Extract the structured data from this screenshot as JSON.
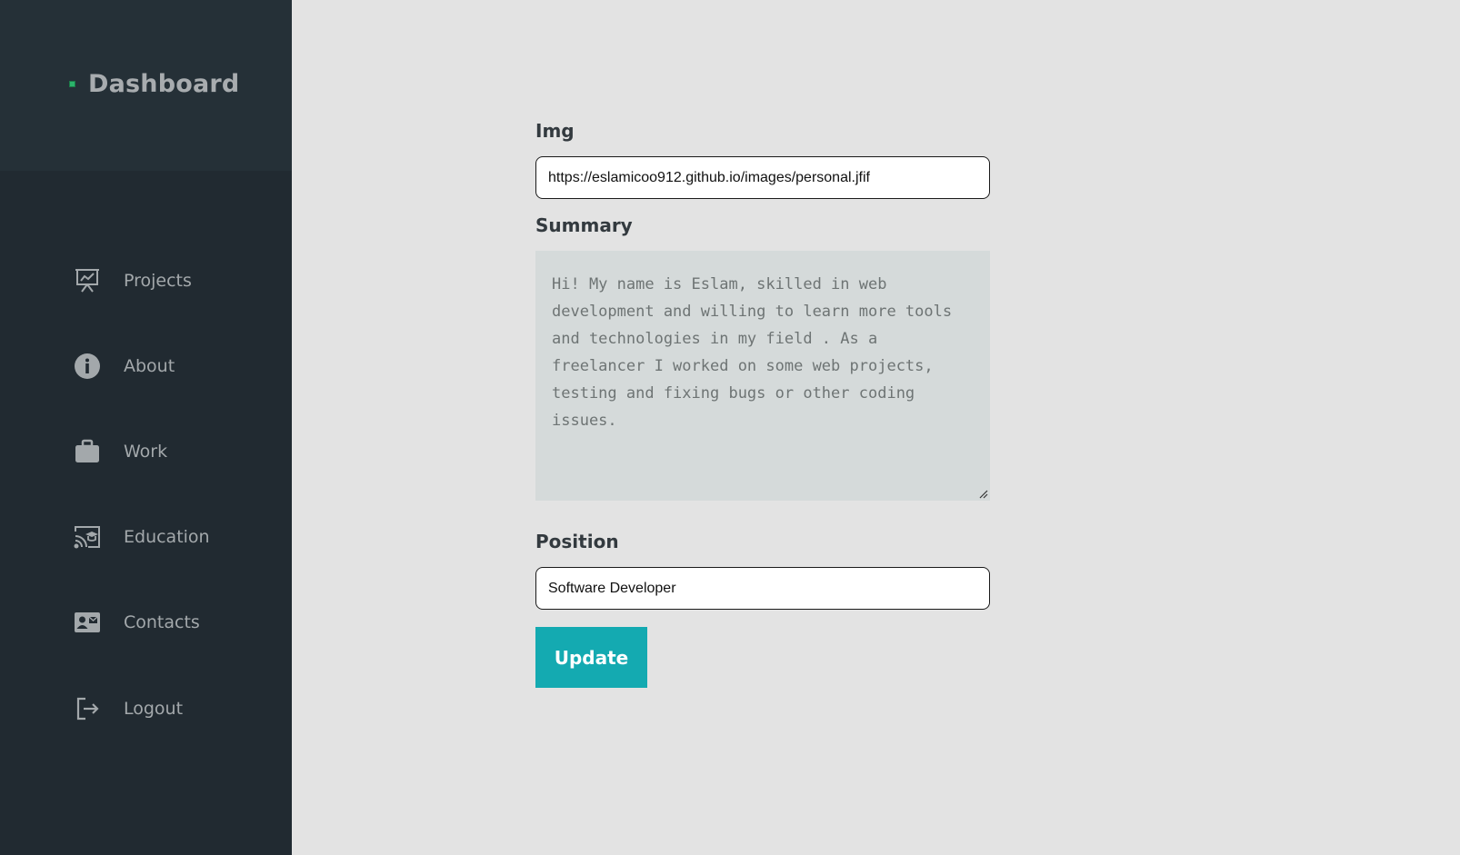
{
  "sidebar": {
    "brand": {
      "title": "Dashboard",
      "icon": "grid-dot-icon",
      "accent": "#2bb36b"
    },
    "items": [
      {
        "label": "Projects",
        "icon": "presentation-chart-icon"
      },
      {
        "label": "About",
        "icon": "info-circle-icon"
      },
      {
        "label": "Work",
        "icon": "briefcase-icon"
      },
      {
        "label": "Education",
        "icon": "cast-graduation-icon"
      },
      {
        "label": "Contacts",
        "icon": "contact-card-icon"
      },
      {
        "label": "Logout",
        "icon": "logout-icon"
      }
    ]
  },
  "form": {
    "img_label": "Img",
    "img_value": "https://eslamicoo912.github.io/images/personal.jfif",
    "summary_label": "Summary",
    "summary_value": "Hi! My name is Eslam, skilled in web\ndevelopment and willing to learn more tools\nand technologies in my field . As a\nfreelancer I worked on some web projects,\ntesting and fixing bugs or other coding\nissues.",
    "position_label": "Position",
    "position_value": "Software Developer",
    "update_label": "Update"
  },
  "colors": {
    "sidebar_bg": "#212a31",
    "brand_bg": "#253037",
    "page_bg": "#e3e3e3",
    "button_bg": "#14aab1"
  }
}
